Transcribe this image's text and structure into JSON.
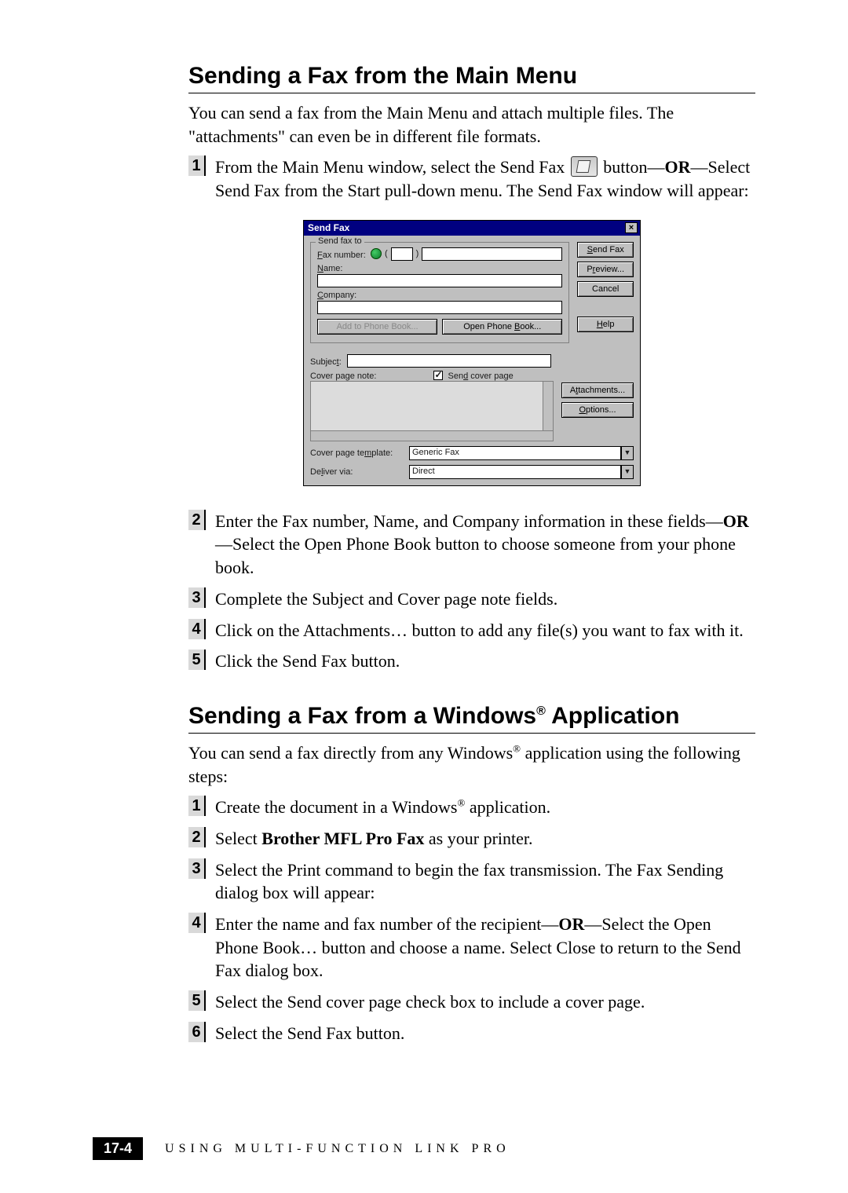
{
  "section1": {
    "title": "Sending a Fax from the Main Menu",
    "intro": "You can send a fax from the Main Menu and attach multiple files. The \"attachments\" can even be in different file formats.",
    "items": [
      {
        "num": "1",
        "html": "From the Main Menu window, select the Send Fax {ICON} button—<b>OR</b>—Select Send Fax  from the Start pull-down menu.  The Send Fax window will appear:"
      },
      {
        "num": "2",
        "html": "Enter the Fax number, Name, and Company information in these fields—<b>OR</b>—Select the Open Phone Book button to choose someone from your phone book."
      },
      {
        "num": "3",
        "html": "Complete the Subject and Cover page note fields."
      },
      {
        "num": "4",
        "html": "Click on the Attachments… button to add any file(s) you want to fax with it."
      },
      {
        "num": "5",
        "html": "Click the Send Fax button."
      }
    ]
  },
  "section2": {
    "title_pre": "Sending a Fax from a Windows",
    "title_sup": "®",
    "title_post": " Application",
    "intro_pre": "You can send a fax directly from any Windows",
    "intro_sup": "®",
    "intro_post": " application using the following steps:",
    "items": [
      {
        "num": "1",
        "html": "Create the document in a Windows<sup class=\"sup\">®</sup> application."
      },
      {
        "num": "2",
        "html": "Select <b>Brother MFL Pro Fax</b> as your printer."
      },
      {
        "num": "3",
        "html": "Select the Print command to begin the fax transmission.  The Fax Sending dialog box will appear:"
      },
      {
        "num": "4",
        "html": "Enter the name and fax number of the recipient—<b>OR</b>—Select the Open Phone Book… button and choose a name. Select Close to return to the Send Fax dialog box."
      },
      {
        "num": "5",
        "html": "Select the Send cover page check box to include a cover page."
      },
      {
        "num": "6",
        "html": "Select the Send Fax button."
      }
    ]
  },
  "dialog": {
    "title": "Send Fax",
    "legend": "Send fax to",
    "labels": {
      "fax_number": "Fax number:",
      "name": "Name:",
      "company": "Company:",
      "subject": "Subject:",
      "cover_note": "Cover page note:",
      "send_cover": "Send cover page",
      "cover_template": "Cover page template:",
      "deliver_via": "Deliver via:"
    },
    "fax_prefix": "(",
    "fax_mid": ")",
    "buttons": {
      "send_fax": "Send Fax",
      "preview": "Preview...",
      "cancel": "Cancel",
      "help": "Help",
      "add_pb": "Add to Phone Book...",
      "open_pb": "Open Phone Book...",
      "attachments": "Attachments...",
      "options": "Options..."
    },
    "cover_template_value": "Generic Fax",
    "deliver_via_value": "Direct",
    "close_x": "×"
  },
  "footer": {
    "page": "17-4",
    "text": "USING MULTI-FUNCTION LINK PRO"
  }
}
